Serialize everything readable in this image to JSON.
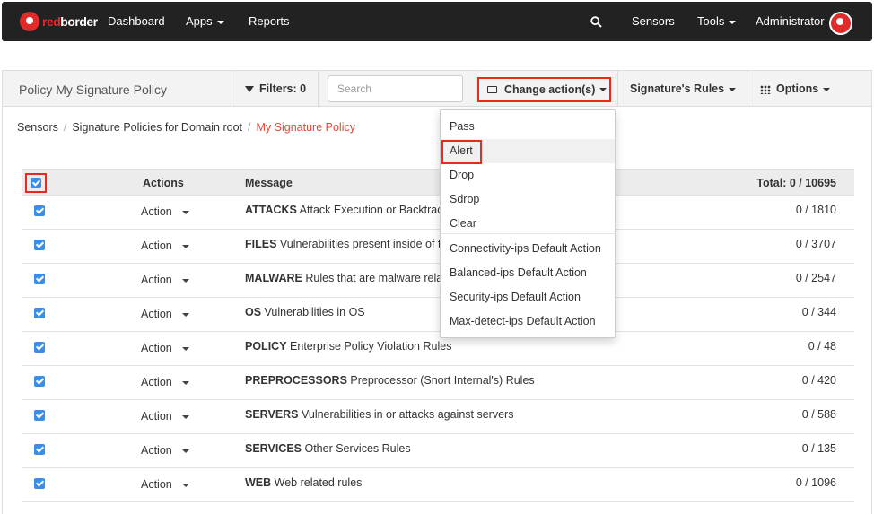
{
  "navbar": {
    "brand_red": "red",
    "brand_white": "border",
    "links": [
      "Dashboard",
      "Apps",
      "Reports"
    ],
    "sensors": "Sensors",
    "tools": "Tools",
    "user": "Administrator",
    "search_icon": "search-icon"
  },
  "header": {
    "title": "Policy My Signature Policy",
    "filters": "Filters: 0",
    "search_placeholder": "Search",
    "change_action": "Change action(s)",
    "signature_rules": "Signature's Rules",
    "options": "Options"
  },
  "breadcrumb": {
    "items": [
      "Sensors",
      "Signature Policies for Domain root",
      "My Signature Policy"
    ]
  },
  "table": {
    "headers": {
      "actions": "Actions",
      "message": "Message",
      "total": "Total: 0 / 10695"
    },
    "rows": [
      {
        "action": "Action",
        "name": "ATTACKS",
        "desc": "Attack Execution or Backtrace",
        "count": "0 / 1810"
      },
      {
        "action": "Action",
        "name": "FILES",
        "desc": "Vulnerabilities present inside of files",
        "count": "0 / 3707"
      },
      {
        "action": "Action",
        "name": "MALWARE",
        "desc": "Rules that are malware related",
        "count": "0 / 2547"
      },
      {
        "action": "Action",
        "name": "OS",
        "desc": "Vulnerabilities in OS",
        "count": "0 / 344"
      },
      {
        "action": "Action",
        "name": "POLICY",
        "desc": "Enterprise Policy Violation Rules",
        "count": "0 / 48"
      },
      {
        "action": "Action",
        "name": "PREPROCESSORS",
        "desc": "Preprocessor (Snort Internal's) Rules",
        "count": "0 / 420"
      },
      {
        "action": "Action",
        "name": "SERVERS",
        "desc": "Vulnerabilities in or attacks against servers",
        "count": "0 / 588"
      },
      {
        "action": "Action",
        "name": "SERVICES",
        "desc": "Other Services Rules",
        "count": "0 / 135"
      },
      {
        "action": "Action",
        "name": "WEB",
        "desc": "Web related rules",
        "count": "0 / 1096"
      }
    ]
  },
  "dropdown": {
    "items": [
      "Pass",
      "Alert",
      "Drop",
      "Sdrop",
      "Clear"
    ],
    "defaults": [
      "Connectivity-ips Default Action",
      "Balanced-ips Default Action",
      "Security-ips Default Action",
      "Max-detect-ips Default Action"
    ]
  },
  "colors": {
    "accent": "#e02b2b",
    "highlight": "#e62b1e",
    "checkbox": "#3b8ee8"
  }
}
